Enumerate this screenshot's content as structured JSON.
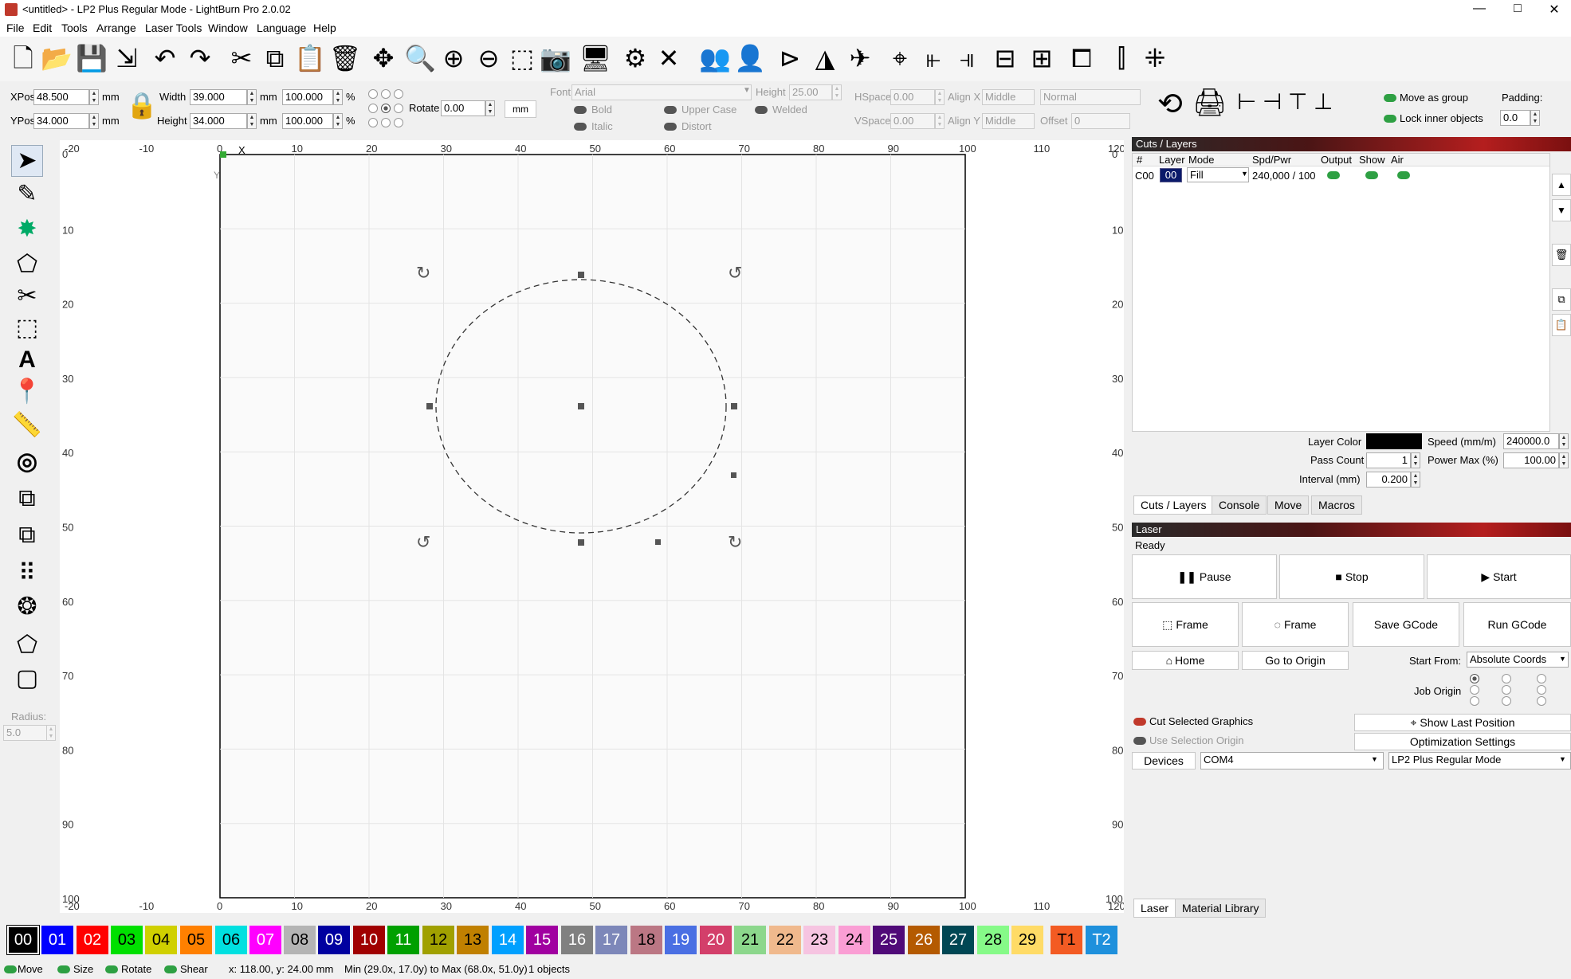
{
  "window": {
    "title": "<untitled> - LP2 Plus Regular Mode - LightBurn Pro 2.0.02",
    "min": "—",
    "max": "□",
    "close": "✕"
  },
  "menu": [
    "File",
    "Edit",
    "Tools",
    "Arrange",
    "Laser Tools",
    "Window",
    "Language",
    "Help"
  ],
  "props": {
    "xpos_label": "XPos",
    "xpos": "48.500",
    "ypos_label": "YPos",
    "ypos": "34.000",
    "unit": "mm",
    "width_label": "Width",
    "width": "39.000",
    "height_label": "Height",
    "height": "34.000",
    "pct_w": "100.000",
    "pct_h": "100.000",
    "pct": "%",
    "rotate_label": "Rotate",
    "rotate": "0.00",
    "mm_button": "mm",
    "font_label": "Font",
    "font": "Arial",
    "text_height_label": "Height",
    "text_height": "25.00",
    "bold": "Bold",
    "italic": "Italic",
    "upper_case": "Upper Case",
    "distort": "Distort",
    "welded": "Welded",
    "hspace_label": "HSpace",
    "hspace": "0.00",
    "vspace_label": "VSpace",
    "vspace": "0.00",
    "alignx_label": "Align X",
    "alignx": "Middle",
    "aligny_label": "Align Y",
    "aligny": "Middle",
    "mode_sel": "Normal",
    "offset_label": "Offset",
    "offset": "0",
    "move_group": "Move as group",
    "lock_inner": "Lock inner objects",
    "padding_label": "Padding:",
    "padding": "0.0"
  },
  "left": {
    "radius_label": "Radius:",
    "radius": "5.0"
  },
  "ruler": {
    "top": [
      "-20",
      "-10",
      "0",
      "10",
      "20",
      "30",
      "40",
      "50",
      "60",
      "70",
      "80",
      "90",
      "100",
      "110",
      "120"
    ],
    "left": [
      "0",
      "10",
      "20",
      "30",
      "40",
      "50",
      "60",
      "70",
      "80",
      "90",
      "100"
    ],
    "x_axis": "X",
    "y_axis": "Y"
  },
  "cuts": {
    "title": "Cuts / Layers",
    "cols": [
      "#",
      "Layer",
      "Mode",
      "Spd/Pwr",
      "Output",
      "Show",
      "Air"
    ],
    "row": {
      "num": "C00",
      "layer": "00",
      "mode": "Fill",
      "spdpwr": "240,000 / 100"
    },
    "layer_color_label": "Layer Color",
    "speed_label": "Speed (mm/m)",
    "speed": "240000.0",
    "pass_label": "Pass Count",
    "pass": "1",
    "power_label": "Power Max (%)",
    "power": "100.00",
    "interval_label": "Interval (mm)",
    "interval": "0.200",
    "tabs": [
      "Cuts / Layers",
      "Console",
      "Move",
      "Macros"
    ]
  },
  "laser": {
    "title": "Laser",
    "status": "Ready",
    "pause": "Pause",
    "stop": "Stop",
    "start": "Start",
    "frame1": "Frame",
    "frame2": "Frame",
    "save_gcode": "Save GCode",
    "run_gcode": "Run GCode",
    "home": "Home",
    "go_origin": "Go to Origin",
    "start_from_label": "Start From:",
    "start_from": "Absolute Coords",
    "job_origin": "Job Origin",
    "cut_selected": "Cut Selected Graphics",
    "use_sel_origin": "Use Selection Origin",
    "show_last": "Show Last Position",
    "opt_settings": "Optimization Settings",
    "devices": "Devices",
    "port": "COM4",
    "device": "LP2 Plus Regular Mode",
    "tabs": [
      "Laser",
      "Material Library"
    ]
  },
  "palette": [
    {
      "label": "00",
      "color": "#000000",
      "text": "#ffffff"
    },
    {
      "label": "01",
      "color": "#0000ff",
      "text": "#ffffff"
    },
    {
      "label": "02",
      "color": "#ff0000",
      "text": "#ffffff"
    },
    {
      "label": "03",
      "color": "#00e000",
      "text": "#000000"
    },
    {
      "label": "04",
      "color": "#d0d000",
      "text": "#000000"
    },
    {
      "label": "05",
      "color": "#ff8000",
      "text": "#000000"
    },
    {
      "label": "06",
      "color": "#00e0e0",
      "text": "#000000"
    },
    {
      "label": "07",
      "color": "#ff00ff",
      "text": "#ffffff"
    },
    {
      "label": "08",
      "color": "#b4b4b4",
      "text": "#000000"
    },
    {
      "label": "09",
      "color": "#0000a0",
      "text": "#ffffff"
    },
    {
      "label": "10",
      "color": "#a00000",
      "text": "#ffffff"
    },
    {
      "label": "11",
      "color": "#00a000",
      "text": "#ffffff"
    },
    {
      "label": "12",
      "color": "#a0a000",
      "text": "#000000"
    },
    {
      "label": "13",
      "color": "#c08000",
      "text": "#000000"
    },
    {
      "label": "14",
      "color": "#00a0ff",
      "text": "#ffffff"
    },
    {
      "label": "15",
      "color": "#a000a0",
      "text": "#ffffff"
    },
    {
      "label": "16",
      "color": "#808080",
      "text": "#ffffff"
    },
    {
      "label": "17",
      "color": "#7d87b9",
      "text": "#ffffff"
    },
    {
      "label": "18",
      "color": "#bb7784",
      "text": "#000000"
    },
    {
      "label": "19",
      "color": "#4a6fe3",
      "text": "#ffffff"
    },
    {
      "label": "20",
      "color": "#d33f6a",
      "text": "#ffffff"
    },
    {
      "label": "21",
      "color": "#8cd78c",
      "text": "#000000"
    },
    {
      "label": "22",
      "color": "#f0b98d",
      "text": "#000000"
    },
    {
      "label": "23",
      "color": "#f6c4e1",
      "text": "#000000"
    },
    {
      "label": "24",
      "color": "#fa9ed4",
      "text": "#000000"
    },
    {
      "label": "25",
      "color": "#500a78",
      "text": "#ffffff"
    },
    {
      "label": "26",
      "color": "#b45a00",
      "text": "#ffffff"
    },
    {
      "label": "27",
      "color": "#004754",
      "text": "#ffffff"
    },
    {
      "label": "28",
      "color": "#86fa88",
      "text": "#000000"
    },
    {
      "label": "29",
      "color": "#ffdb66",
      "text": "#000000"
    },
    {
      "label": "T1",
      "color": "#f35b23",
      "text": "#000000"
    },
    {
      "label": "T2",
      "color": "#1e90dc",
      "text": "#ffffff"
    }
  ],
  "status": {
    "move": "Move",
    "size": "Size",
    "rotate": "Rotate",
    "shear": "Shear",
    "coords": "x: 118.00, y: 24.00 mm",
    "minmax": "Min (29.0x, 17.0y) to Max (68.0x, 51.0y)",
    "objects": "1 objects"
  }
}
